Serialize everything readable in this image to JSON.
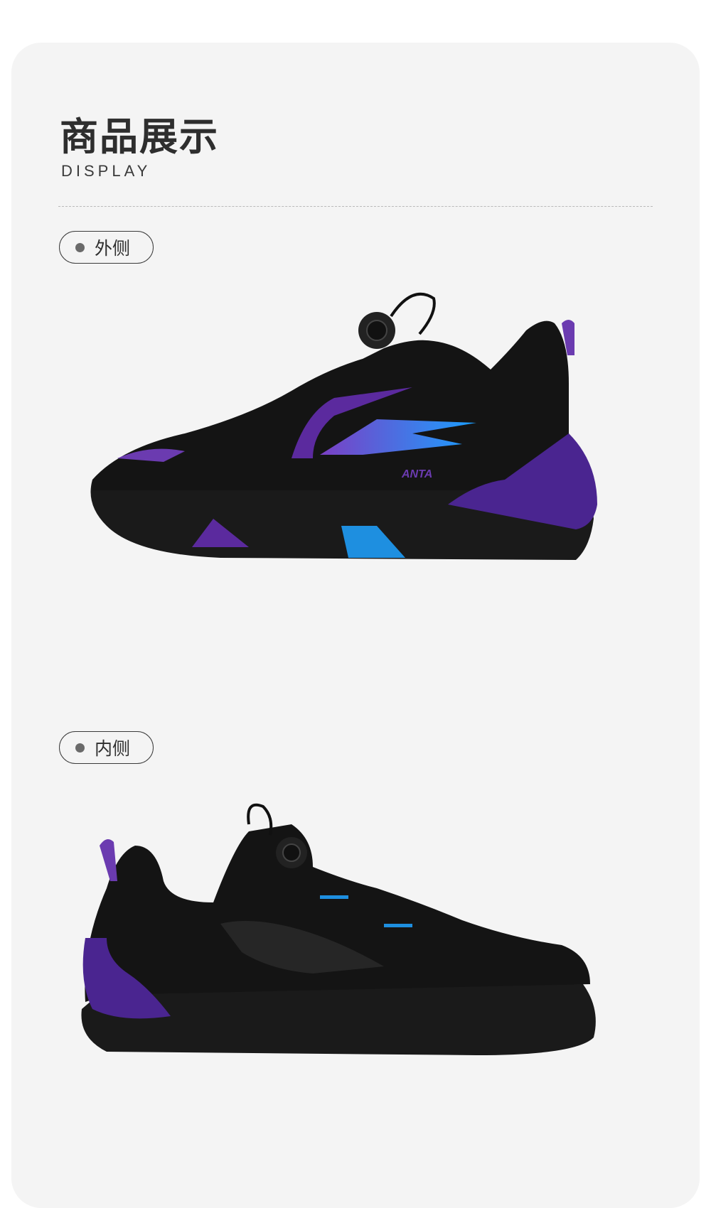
{
  "section": {
    "title": "商品展示",
    "subtitle": "DISPLAY"
  },
  "views": [
    {
      "label": "外侧",
      "brand_text": "ANTA"
    },
    {
      "label": "内侧"
    }
  ],
  "colors": {
    "card_bg": "#f4f4f4",
    "shoe_black": "#141414",
    "accent_purple": "#5b2a9e",
    "accent_blue": "#1e8fe0"
  }
}
